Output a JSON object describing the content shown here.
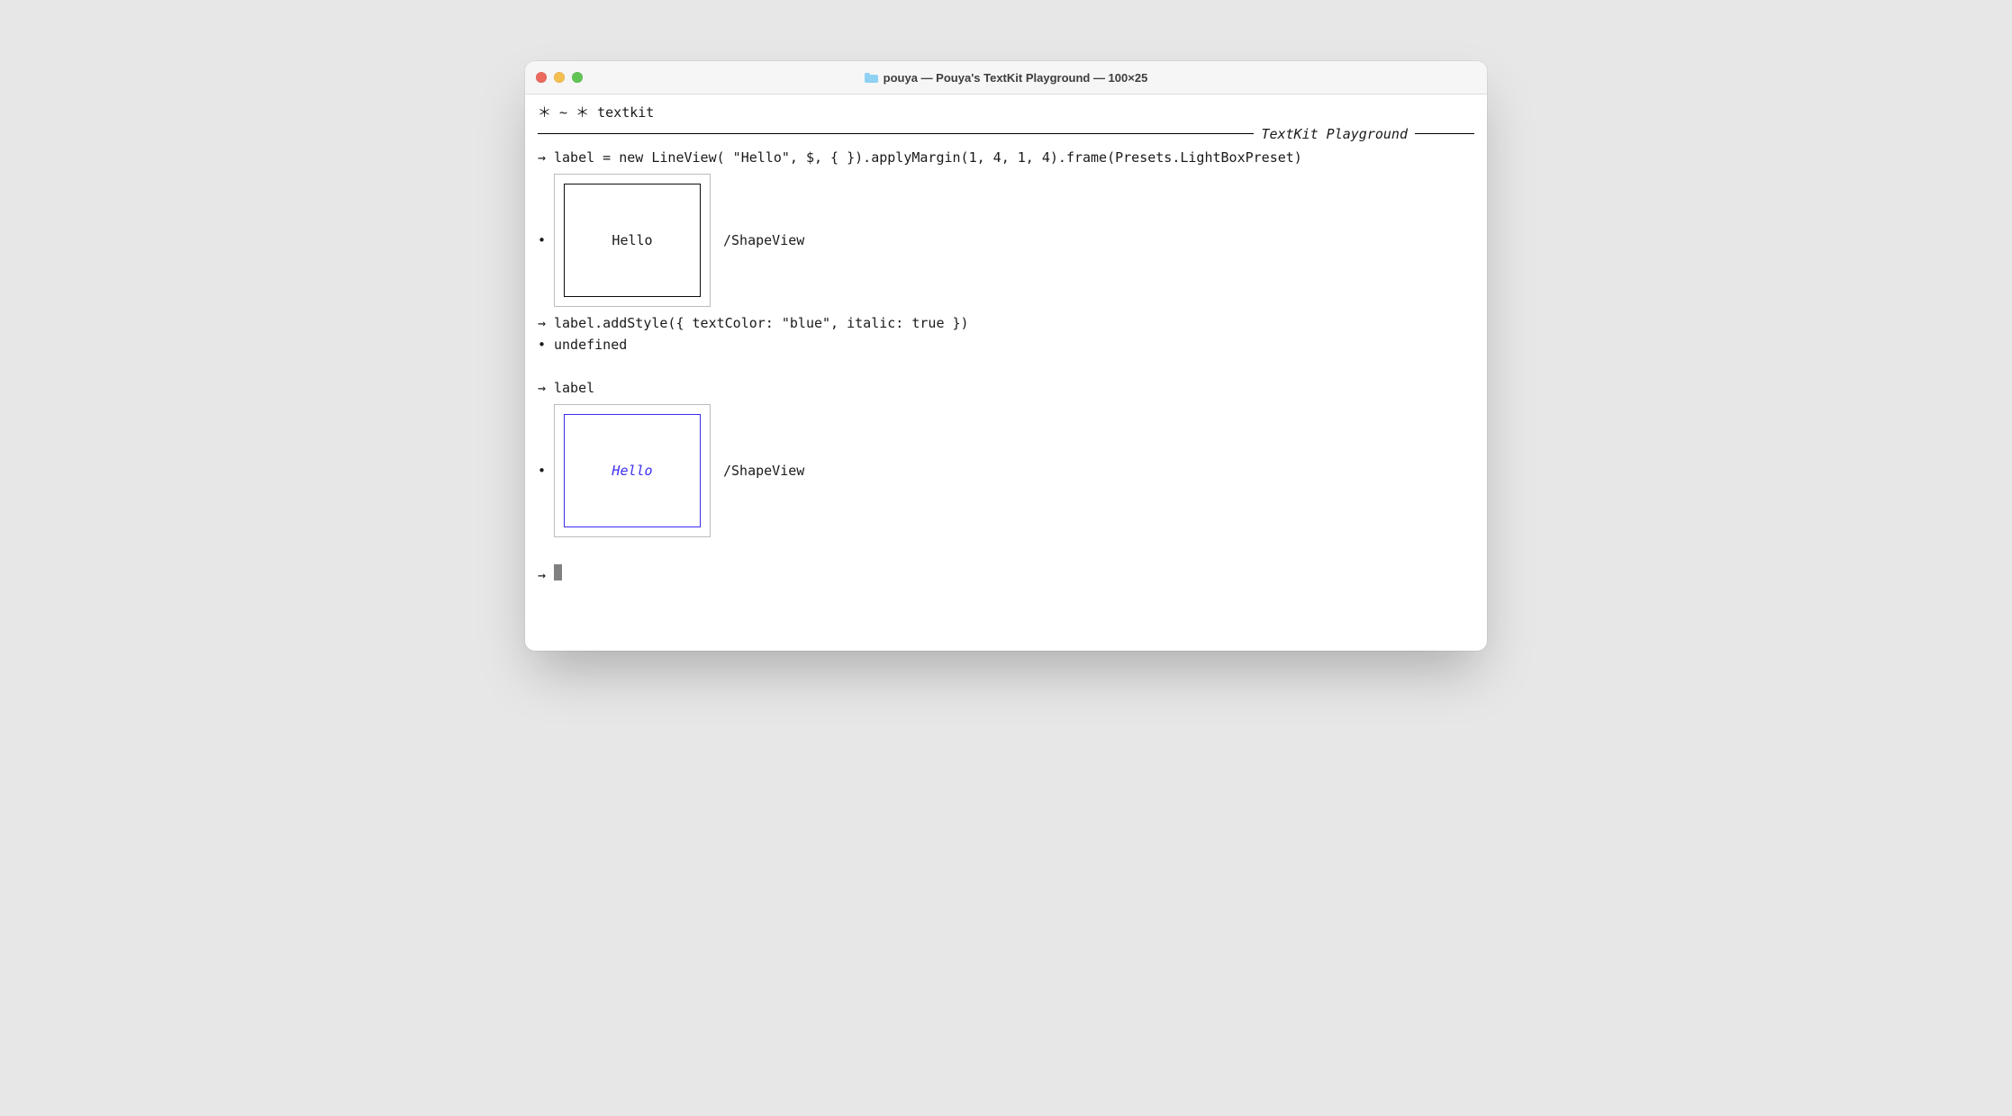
{
  "window": {
    "title_dir": "pouya",
    "title_full": "pouya — Pouya's TextKit Playground — 100×25"
  },
  "header": {
    "prompt": "＊ ~ ＊ textkit",
    "banner_label": "TextKit Playground"
  },
  "lines": {
    "cmd1": "label = new LineView( \"Hello\", $, { }).applyMargin(1, 4, 1, 4).frame(Presets.LightBoxPreset)",
    "out1_text": "Hello",
    "out1_tag": "/ShapeView",
    "cmd2": "label.addStyle({ textColor: \"blue\", italic: true })",
    "out2": "undefined",
    "cmd3": "label",
    "out3_text": "Hello",
    "out3_tag": "/ShapeView"
  },
  "symbols": {
    "arrow": "→",
    "bullet": "•"
  }
}
